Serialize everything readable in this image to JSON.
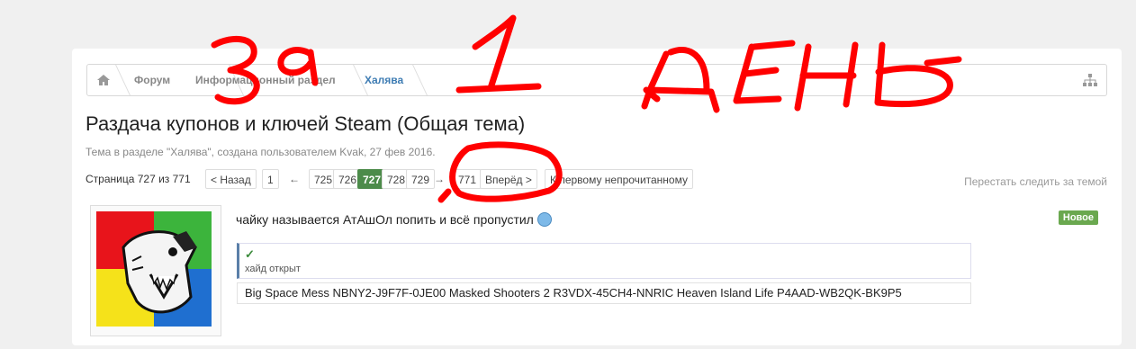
{
  "breadcrumb": {
    "items": [
      "Форум",
      "Информационный раздел",
      "Халява"
    ]
  },
  "thread": {
    "title": "Раздача купонов и ключей Steam (Общая тема)",
    "subtitle": "Тема в разделе \"Халява\", создана пользователем Kvak, 27 фев 2016."
  },
  "pager": {
    "label": "Страница 727 из 771",
    "prev": "< Назад",
    "first": "1",
    "arrow_left": "←",
    "pages": [
      "725",
      "726",
      "727",
      "728",
      "729"
    ],
    "current": "727",
    "arrow_right": "→",
    "last": "771",
    "next": "Вперёд >",
    "first_unread": "К первому непрочитанному"
  },
  "unwatch": "Перестать следить за темой",
  "post": {
    "text": "чайку называется АтАшОл попить и всё пропустил",
    "badge": "Новое",
    "hide_check": "✓",
    "hide_label": "хайд открыт",
    "code": "Big Space Mess NBNY2-J9F7F-0JE00 Masked Shooters 2 R3VDX-45CH4-NNRIC Heaven Island Life P4AAD-WB2QK-BK9P5"
  },
  "annotation": {
    "text": "За 1 день",
    "color": "#ff0000"
  },
  "colors": {
    "accent": "#3e7cb3",
    "current_page": "#4c8b4a",
    "new_badge": "#6aa84f"
  }
}
